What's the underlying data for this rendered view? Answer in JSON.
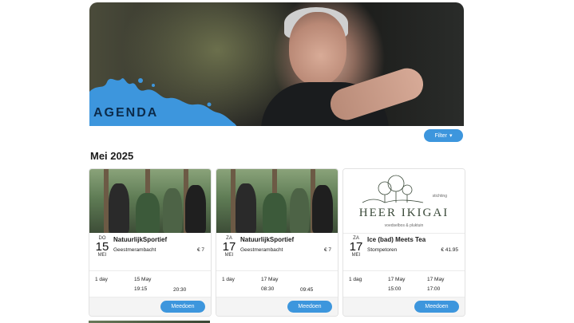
{
  "hero": {
    "title": "AGENDA"
  },
  "filter": {
    "label": "Filter",
    "icon": "caret-down-icon"
  },
  "month": "Mei 2025",
  "colors": {
    "accent": "#3d96dd",
    "splash": "#3d96dd"
  },
  "events": [
    {
      "image": "natuurlijksportief-photo",
      "dow": "DO",
      "day": "15",
      "mon": "MEI",
      "title": "NatuurlijkSportief",
      "location": "Geestmerambacht",
      "price": "€ 7",
      "duration": "1 day",
      "date1": "15 May",
      "date2": "",
      "time1": "19:15",
      "time2": "20:30",
      "button": "Meedoen"
    },
    {
      "image": "natuurlijksportief-photo",
      "dow": "ZA",
      "day": "17",
      "mon": "MEI",
      "title": "NatuurlijkSportief",
      "location": "Geestmerambacht",
      "price": "€ 7",
      "duration": "1 day",
      "date1": "17 May",
      "date2": "",
      "time1": "08:30",
      "time2": "09:45",
      "button": "Meedoen"
    },
    {
      "image": "heer-ikigai-logo",
      "dow": "ZA",
      "day": "17",
      "mon": "MEI",
      "title": "Ice (bad) Meets Tea",
      "location": "Stompetoren",
      "price": "€ 41.95",
      "duration": "1 dag",
      "date1": "17 May",
      "date2": "17 May",
      "time1": "15:00",
      "time2": "17:00",
      "button": "Meedoen",
      "logo": {
        "name": "HEER IKIGAI",
        "stichting": "stichting",
        "tagline": "voedselbos & pluktuin"
      }
    }
  ]
}
